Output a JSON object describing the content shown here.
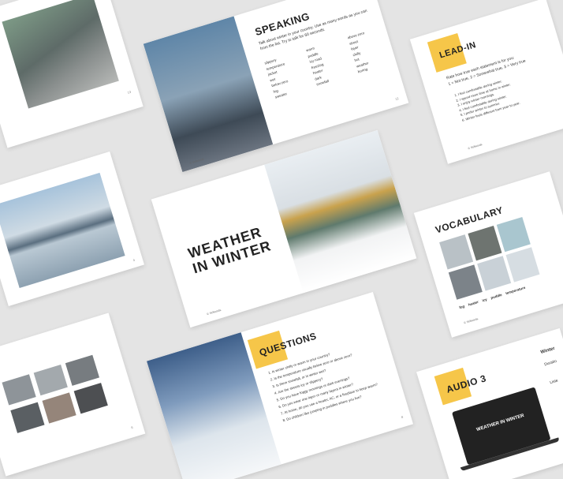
{
  "speaking": {
    "title": "SPEAKING",
    "instructions": "Talk about winter in your country. Use as many words as you can from the list. Try to talk for 60 seconds.",
    "col1": [
      "slippery",
      "temperature",
      "jacket",
      "wet",
      "below zero",
      "fog",
      "sweater"
    ],
    "col2": [
      "warm",
      "puddle",
      "icy road",
      "freezing",
      "heater",
      "dark",
      "snowfall"
    ],
    "col3": [
      "above zero",
      "street",
      "layer",
      "chilly",
      "hot",
      "weather",
      "boring"
    ],
    "page": "12"
  },
  "leadin": {
    "title": "LEAD-IN",
    "instructions": "Rate how true each statement is for you:",
    "scale": "1 = Not true, 2 = Somewhat true, 3 = Very true",
    "items": [
      "I feel comfortable during winter.",
      "I spend more time at home in winter.",
      "I enjoy winter mornings.",
      "I feel comfortable during winter.",
      "I prefer winter to summer.",
      "Winter feels different from year to year."
    ]
  },
  "cover": {
    "line1": "WEATHER",
    "line2": "IN WINTER"
  },
  "vocabulary": {
    "title": "VOCABULARY",
    "labels": [
      "fog",
      "heater",
      "icy",
      "puddle",
      "temperature"
    ]
  },
  "questions": {
    "title": "QUESTIONS",
    "items": [
      "Is winter chilly or warm in your country?",
      "Is the temperature usually below zero or above zero?",
      "Is there snowfall, or is winter wet?",
      "Are the streets icy or slippery?",
      "Do you have foggy mornings or dark evenings?",
      "Do you wear one layer or many layers in winter?",
      "At home, do you use a heater, AC, or a fireplace to keep warm?",
      "Do children like jumping in puddles where you live?"
    ],
    "page": "8"
  },
  "audio": {
    "title": "AUDIO 3",
    "screen_title": "WEATHER IN WINTER",
    "side_title": "Winter",
    "side_label1": "Duratio",
    "side_label2": "Liste"
  },
  "brand": "© Sellwords",
  "pages": {
    "top_left": "13",
    "mid_left": "4",
    "bottom_left": "6"
  }
}
